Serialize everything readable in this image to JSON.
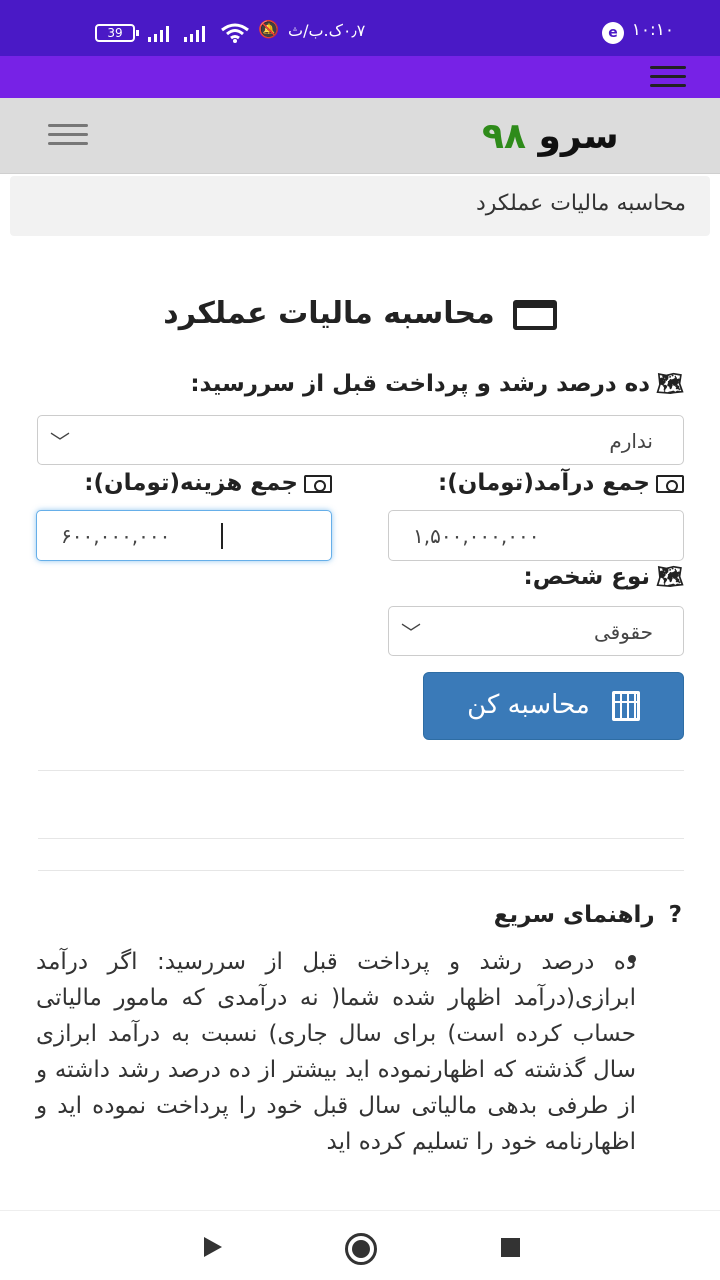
{
  "status_bar": {
    "time": "۱۰:۱۰",
    "carrier_text": "۰٫۷ک.ب/ث",
    "battery": "39"
  },
  "header": {
    "logo_word": "سرو",
    "logo_number": "۹۸"
  },
  "breadcrumb": "محاسبه مالیات عملکرد",
  "page_title": "محاسبه مالیات عملکرد",
  "form": {
    "growth_label": "ده درصد رشد و پرداخت قبل از سررسید:",
    "growth_value": "ندارم",
    "income_label": "جمع درآمد(تومان):",
    "income_value": "۱,۵۰۰,۰۰۰,۰۰۰",
    "cost_label": "جمع هزینه(تومان):",
    "cost_value": "۶۰۰,۰۰۰,۰۰۰",
    "person_type_label": "نوع شخص:",
    "person_type_value": "حقوقی",
    "calculate_label": "محاسبه کن"
  },
  "guide": {
    "title": "راهنمای سریع",
    "text": "ده درصد رشد و پرداخت قبل از سررسید: اگر درآمد ابرازی(درآمد اظهار شده شما( نه درآمدی که مامور مالیاتی حساب کرده است) برای سال جاری) نسبت به درآمد ابرازی سال گذشته که اظهارنموده اید بیشتر از ده درصد رشد داشته و از طرفی بدهی مالیاتی سال قبل خود را پرداخت نموده اید و اظهارنامه خود را تسلیم کرده اید"
  },
  "icons": {
    "map": "map-icon",
    "money": "money-icon",
    "window": "window-icon",
    "calculator": "calculator-icon",
    "question": "question-icon"
  },
  "colors": {
    "status_bar": "#4a19c6",
    "top_bar": "#7722e6",
    "logo_number": "#2e8b1a",
    "primary_button": "#3a7ab8"
  }
}
